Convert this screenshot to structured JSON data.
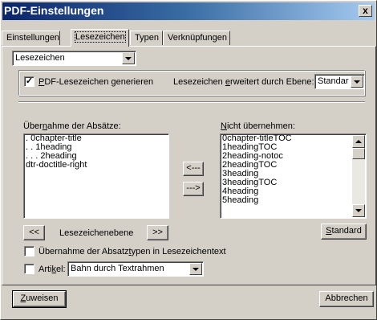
{
  "window": {
    "title": "PDF-Einstellungen",
    "close_glyph": "x"
  },
  "tabs": [
    {
      "label": "Einstellungen"
    },
    {
      "label": "Lesezeichen"
    },
    {
      "label": "Typen"
    },
    {
      "label": "Verknüpfungen"
    }
  ],
  "top_select": {
    "value": "Lesezeichen"
  },
  "generate": {
    "checked_glyph": "✓",
    "label_u": "P",
    "label_rest": "DF-Lesezeichen generieren",
    "level_label_pre": "Lesezeichen ",
    "level_label_u": "e",
    "level_label_post": "rweitert durch Ebene:",
    "level_value": "Standar"
  },
  "left_list": {
    "label_pre": "Über",
    "label_u": "n",
    "label_post": "ahme der Absätze:",
    "items": [
      ". 0chapter-title",
      ". . 1heading",
      ". . . 2heading",
      "dtr-doctitle-right"
    ]
  },
  "right_list": {
    "label_u": "N",
    "label_post": "icht übernehmen:",
    "items": [
      "0chapter-titleTOC",
      "1headingTOC",
      "2heading-notoc",
      "2headingTOC",
      "3heading",
      "3headingTOC",
      "4heading",
      "5heading"
    ]
  },
  "move_buttons": {
    "left": "<---",
    "right": "--->"
  },
  "level_nav": {
    "prev": "<<",
    "label": "Lesezeichenebene",
    "next": ">>"
  },
  "standard_button": {
    "label_u": "S",
    "label_rest": "tandard"
  },
  "absatztypen": {
    "label_pre": "Übernahme der Absatz",
    "label_u": "t",
    "label_post": "ypen in Lesezeichentext"
  },
  "artikel": {
    "label_pre": "Arti",
    "label_u": "k",
    "label_post": "el:",
    "value": "Bahn durch Textrahmen"
  },
  "footer": {
    "assign_u": "Z",
    "assign_rest": "uweisen",
    "cancel": "Abbrechen"
  }
}
